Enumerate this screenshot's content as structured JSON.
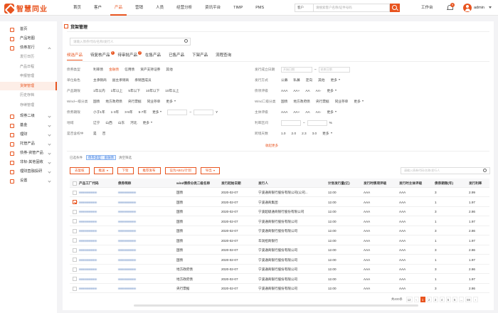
{
  "brand": {
    "name": "智慧同业",
    "color": "#e8541f"
  },
  "nav": {
    "items": [
      "首页",
      "客户",
      "产品",
      "营销",
      "人员",
      "经营分析",
      "资讯平台",
      "TIMP",
      "PMS"
    ],
    "active": 2
  },
  "search": {
    "type": "客户",
    "placeholder": "请搜索客户名称/证件号码"
  },
  "header": {
    "workbench": "工作台",
    "notify_count": "9",
    "user": "admin"
  },
  "sidebar": {
    "items": [
      {
        "label": "首页",
        "icon": "home-icon"
      },
      {
        "label": "产品地图",
        "icon": "map-icon"
      },
      {
        "label": "债券发行",
        "icon": "bond-icon",
        "open": true
      },
      {
        "label": "现券二级",
        "icon": "exchange-icon"
      },
      {
        "label": "基金",
        "icon": "fund-icon"
      },
      {
        "label": "理财",
        "icon": "wealth-icon"
      },
      {
        "label": "托管产品",
        "icon": "custody-icon"
      },
      {
        "label": "债券-资管产品",
        "icon": "asset-icon"
      },
      {
        "label": "非标-其他固收",
        "icon": "fixed-income-icon"
      },
      {
        "label": "理财直融投研",
        "icon": "research-icon"
      },
      {
        "label": "设置",
        "icon": "settings-icon"
      }
    ],
    "subitems": [
      "发行日历",
      "产品日程",
      "申报管理",
      "货架管理",
      "历史存档",
      "存续管理"
    ],
    "active_sub": 3
  },
  "page": {
    "title": "货架管理",
    "search_placeholder": "请输入债券代码/名称/发行人",
    "tabs": [
      {
        "label": "候选产品",
        "badge": ""
      },
      {
        "label": "待复核产品",
        "badge": "2"
      },
      {
        "label": "待审批产品",
        "badge": "2"
      },
      {
        "label": "在售产品",
        "badge": ""
      },
      {
        "label": "已售产品",
        "badge": ""
      },
      {
        "label": "下架产品",
        "badge": ""
      },
      {
        "label": "流程查询",
        "badge": ""
      }
    ]
  },
  "filters": {
    "left": [
      {
        "label": "债券类型",
        "opts": [
          "利率债",
          "金融债",
          "信用债",
          "资产支持证券",
          "其他"
        ],
        "sel": 1
      },
      {
        "label": "单位角色",
        "opts": [
          "主承销商",
          "副主承销商",
          "承销团成员"
        ]
      },
      {
        "label": "产品期限",
        "opts": [
          "1年以内",
          "1年以上",
          "5年以下",
          "10年以下",
          "10年以上"
        ]
      },
      {
        "label": "Wind一级分类",
        "opts": [
          "国债",
          "地方政府债",
          "央行票据",
          "同业存单"
        ],
        "more": "更多"
      },
      {
        "label": "债券期限",
        "opts": [
          "小于1年",
          "1-3年",
          "3-5年",
          "5-7年"
        ],
        "more": "更多",
        "unit": "Y"
      },
      {
        "label": "地域",
        "opts": [
          "辽宁",
          "山西",
          "山东",
          "河北"
        ],
        "more": "更多"
      },
      {
        "label": "是否含权中",
        "opts": [
          "是",
          "否"
        ]
      }
    ],
    "right": [
      {
        "label": "发行成立日期",
        "date_from": "开始日期",
        "date_to": "结束日期"
      },
      {
        "label": "发行方式",
        "opts": [
          "公募",
          "私募",
          "定向",
          "其他"
        ],
        "more": "更多"
      },
      {
        "label": "债项评级",
        "opts": [
          "AAA",
          "AA+",
          "AA",
          "AA-"
        ],
        "more": "更多"
      },
      {
        "label": "Wind二级分类",
        "opts": [
          "国债",
          "地方政府债",
          "央行票据",
          "同业存单"
        ],
        "more": "更多"
      },
      {
        "label": "主体评级",
        "opts": [
          "AAA",
          "AA+",
          "AA",
          "AA-"
        ],
        "more": "更多"
      },
      {
        "label": "利率区间",
        "unit": "%"
      },
      {
        "label": "跨境天数",
        "opts": [
          "1.0",
          "2.0",
          "2.3",
          "3.0"
        ],
        "more": "更多"
      }
    ],
    "collapse": "收起更多"
  },
  "conditions": {
    "label": "已选条件",
    "tag1": "债券类型：金融债",
    "clear": "清空筛选"
  },
  "toolbar": {
    "buttons": [
      "去复核",
      "推送",
      "下架",
      "推荐发布",
      "设为AB01/计划",
      "导出"
    ],
    "dropdown": [
      false,
      true,
      false,
      false,
      false,
      true
    ],
    "search_placeholder": "请输入债券代码/名称/发行人"
  },
  "table": {
    "headers": [
      "产品工厂代码",
      "债券简称",
      "wind债券分类二级名称",
      "发行起始日期",
      "发行人",
      "计划发行量(亿)",
      "发行时债项评级",
      "发行时主体评级",
      "债券期限(年)",
      "发行利率"
    ],
    "rows": [
      {
        "checked": false,
        "code": "",
        "name": "",
        "type": "国债",
        "date": "2020-02-07",
        "issuer": "宁波通商银行股份有限公司(公司...",
        "amount": "12.00",
        "r1": "AAA",
        "r2": "AAA",
        "term": "3",
        "rate": "2.99"
      },
      {
        "checked": true,
        "code": "",
        "name": "",
        "type": "国债",
        "date": "2020-02-07",
        "issuer": "宁波通商集团",
        "amount": "12.00",
        "r1": "AAA",
        "r2": "AAA",
        "term": "1",
        "rate": "1.97"
      },
      {
        "checked": false,
        "code": "",
        "name": "",
        "type": "国债",
        "date": "2020-02-07",
        "issuer": "宁波超级通商银行股份有限公司",
        "amount": "12.00",
        "r1": "AAA",
        "r2": "AAA",
        "term": "3",
        "rate": "2.86"
      },
      {
        "checked": false,
        "code": "",
        "name": "",
        "type": "国债",
        "date": "2020-02-07",
        "issuer": "宁波通商银行股份有限公司",
        "amount": "12.00",
        "r1": "AAA",
        "r2": "AAA",
        "term": "1",
        "rate": "1.97"
      },
      {
        "checked": false,
        "code": "",
        "name": "",
        "type": "国债",
        "date": "2020-02-07",
        "issuer": "宁波通商银行股份有限公司",
        "amount": "12.00",
        "r1": "AAA",
        "r2": "AAA",
        "term": "3",
        "rate": "2.86"
      },
      {
        "checked": false,
        "code": "",
        "name": "",
        "type": "国债",
        "date": "2020-02-07",
        "issuer": "华润招商银行",
        "amount": "12.00",
        "r1": "AAA",
        "r2": "AAA",
        "term": "1",
        "rate": "1.97"
      },
      {
        "checked": false,
        "code": "",
        "name": "",
        "type": "国债",
        "date": "2020-02-07",
        "issuer": "宁波通商银行股份有限公司",
        "amount": "12.00",
        "r1": "AAA",
        "r2": "AAA",
        "term": "3",
        "rate": "2.86"
      },
      {
        "checked": false,
        "code": "",
        "name": "",
        "type": "国债",
        "date": "2020-02-07",
        "issuer": "宁波通商银行股份有限公司",
        "amount": "12.00",
        "r1": "AAA",
        "r2": "AAA",
        "term": "1",
        "rate": "1.97"
      },
      {
        "checked": false,
        "code": "",
        "name": "",
        "type": "地方政府债",
        "date": "2020-02-07",
        "issuer": "宁波通商银行股份有限公司",
        "amount": "12.00",
        "r1": "AAA",
        "r2": "AAA",
        "term": "3",
        "rate": "2.86"
      },
      {
        "checked": false,
        "code": "",
        "name": "",
        "type": "地方政府债",
        "date": "2020-02-07",
        "issuer": "宁波通商银行股份有限公司",
        "amount": "12.00",
        "r1": "AAA",
        "r2": "AAA",
        "term": "1",
        "rate": "1.97"
      },
      {
        "checked": false,
        "code": "",
        "name": "",
        "type": "央行票据",
        "date": "2020-02-07",
        "issuer": "宁波通商银行股份有限公司",
        "amount": "12.00",
        "r1": "AAA",
        "r2": "AAA",
        "term": "3",
        "rate": "2.86"
      }
    ]
  },
  "pager": {
    "total": "共400条",
    "size": "12",
    "pages": [
      "1",
      "2",
      "3",
      "4",
      "5",
      "6",
      "...",
      "59"
    ],
    "active": 0
  }
}
